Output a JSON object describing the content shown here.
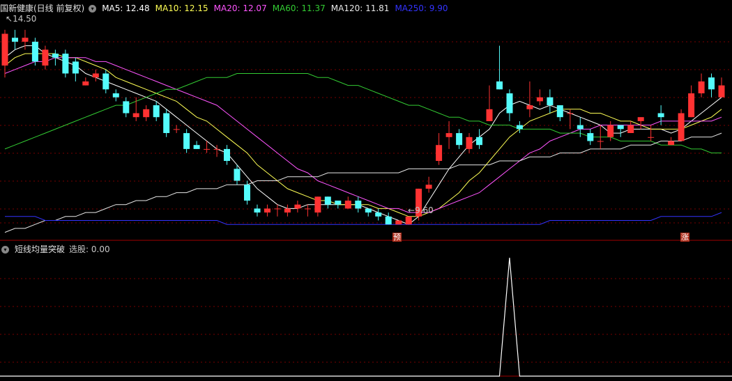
{
  "header": {
    "title": "国新健康(日线 前复权)",
    "ma": [
      {
        "label": "MA5: 12.48",
        "color": "#ffffff"
      },
      {
        "label": "MA10: 12.15",
        "color": "#ffff55"
      },
      {
        "label": "MA20: 12.07",
        "color": "#ff55ff"
      },
      {
        "label": "MA60: 11.37",
        "color": "#33cc33"
      },
      {
        "label": "MA120: 11.81",
        "color": "#e8e8e8"
      },
      {
        "label": "MA250: 9.90",
        "color": "#3333ff"
      }
    ]
  },
  "indicator": {
    "title": "短线均量突破",
    "value": "选股: 0.00"
  },
  "annotations": {
    "high": "14.50",
    "low": "9.60",
    "tag_pre": "预",
    "tag_rise": "涨"
  },
  "colors": {
    "up": "#ff3232",
    "down": "#54fcfc",
    "grid": "#7a0000",
    "border": "#a00000"
  },
  "chart_data": {
    "type": "candlestick",
    "ylim": [
      9.2,
      14.9
    ],
    "candles": [
      [
        13.6,
        14.4,
        14.5,
        13.3
      ],
      [
        14.3,
        14.2,
        14.5,
        14.0
      ],
      [
        14.2,
        14.3,
        14.5,
        14.0
      ],
      [
        14.2,
        13.7,
        14.3,
        13.6
      ],
      [
        13.6,
        14.0,
        14.1,
        13.5
      ],
      [
        13.9,
        13.8,
        14.0,
        13.6
      ],
      [
        13.9,
        13.4,
        14.0,
        13.3
      ],
      [
        13.7,
        13.4,
        13.8,
        13.2
      ],
      [
        13.1,
        13.2,
        13.3,
        13.1
      ],
      [
        13.3,
        13.4,
        13.5,
        13.2
      ],
      [
        13.4,
        13.0,
        13.5,
        12.9
      ],
      [
        12.9,
        12.8,
        13.0,
        12.7
      ],
      [
        12.7,
        12.4,
        12.8,
        12.3
      ],
      [
        12.3,
        12.4,
        12.8,
        12.2
      ],
      [
        12.3,
        12.5,
        12.6,
        12.2
      ],
      [
        12.6,
        12.3,
        12.7,
        12.2
      ],
      [
        12.4,
        11.9,
        12.5,
        11.8
      ],
      [
        12.0,
        12.0,
        12.1,
        11.9
      ],
      [
        11.9,
        11.5,
        12.0,
        11.4
      ],
      [
        11.6,
        11.5,
        11.7,
        11.5
      ],
      [
        11.5,
        11.5,
        11.7,
        11.4
      ],
      [
        11.5,
        11.5,
        11.6,
        11.3
      ],
      [
        11.5,
        11.2,
        11.6,
        11.1
      ],
      [
        11.0,
        10.7,
        11.1,
        10.6
      ],
      [
        10.6,
        10.2,
        10.7,
        10.1
      ],
      [
        10.0,
        9.9,
        10.1,
        9.8
      ],
      [
        9.9,
        10.0,
        10.1,
        9.8
      ],
      [
        10.0,
        10.0,
        10.1,
        9.8
      ],
      [
        9.9,
        10.0,
        10.1,
        9.8
      ],
      [
        10.0,
        10.1,
        10.2,
        9.9
      ],
      [
        10.0,
        10.0,
        10.1,
        9.8
      ],
      [
        9.9,
        10.3,
        10.3,
        9.8
      ],
      [
        10.3,
        10.1,
        10.3,
        10.0
      ],
      [
        10.2,
        10.1,
        10.2,
        10.0
      ],
      [
        10.0,
        10.2,
        10.3,
        10.0
      ],
      [
        10.2,
        10.0,
        10.3,
        9.9
      ],
      [
        10.0,
        9.9,
        10.0,
        9.8
      ],
      [
        9.9,
        9.8,
        10.0,
        9.7
      ],
      [
        9.8,
        9.6,
        9.9,
        9.6
      ],
      [
        9.6,
        9.7,
        9.7,
        9.6
      ],
      [
        9.6,
        9.8,
        9.8,
        9.6
      ],
      [
        9.8,
        10.5,
        10.5,
        9.7
      ],
      [
        10.5,
        10.6,
        10.8,
        10.4
      ],
      [
        11.2,
        11.6,
        11.9,
        11.1
      ],
      [
        11.8,
        11.9,
        12.2,
        11.5
      ],
      [
        11.9,
        11.6,
        12.0,
        11.5
      ],
      [
        11.5,
        11.8,
        11.9,
        11.4
      ],
      [
        11.8,
        11.6,
        12.0,
        11.5
      ],
      [
        12.2,
        12.5,
        13.1,
        12.2
      ],
      [
        13.2,
        13.0,
        14.1,
        13.0
      ],
      [
        12.9,
        12.4,
        13.0,
        12.2
      ],
      [
        12.1,
        12.0,
        12.2,
        11.9
      ],
      [
        12.5,
        12.6,
        13.2,
        12.3
      ],
      [
        12.7,
        12.8,
        13.0,
        12.6
      ],
      [
        12.8,
        12.6,
        13.0,
        12.4
      ],
      [
        12.6,
        12.3,
        12.6,
        12.2
      ],
      [
        12.4,
        12.4,
        12.5,
        12.0
      ],
      [
        12.1,
        12.0,
        12.3,
        11.8
      ],
      [
        11.9,
        11.7,
        12.0,
        11.6
      ],
      [
        11.7,
        11.7,
        12.1,
        11.5
      ],
      [
        11.8,
        12.1,
        12.2,
        11.7
      ],
      [
        12.1,
        12.0,
        12.1,
        11.8
      ],
      [
        11.9,
        12.1,
        12.2,
        11.9
      ],
      [
        12.2,
        12.3,
        12.3,
        12.0
      ],
      [
        11.8,
        11.8,
        12.1,
        11.7
      ],
      [
        12.4,
        12.3,
        12.6,
        12.1
      ],
      [
        11.6,
        11.7,
        11.8,
        11.6
      ],
      [
        11.7,
        12.4,
        12.5,
        11.7
      ],
      [
        12.3,
        12.9,
        13.1,
        12.3
      ],
      [
        12.9,
        13.2,
        13.4,
        12.8
      ],
      [
        13.3,
        13.0,
        13.4,
        12.8
      ],
      [
        12.8,
        13.1,
        13.3,
        12.8
      ]
    ],
    "ma": {
      "MA5": [
        13.8,
        14.0,
        14.1,
        14.1,
        13.9,
        13.8,
        13.7,
        13.6,
        13.4,
        13.3,
        13.2,
        13.1,
        13.0,
        12.9,
        12.8,
        12.7,
        12.5,
        12.3,
        12.1,
        11.9,
        11.7,
        11.5,
        11.4,
        11.1,
        10.8,
        10.5,
        10.3,
        10.1,
        10.0,
        10.0,
        10.1,
        10.1,
        10.1,
        10.1,
        10.1,
        10.1,
        10.0,
        9.9,
        9.8,
        9.7,
        9.6,
        9.8,
        10.2,
        10.6,
        11.0,
        11.3,
        11.6,
        11.8,
        12.0,
        12.4,
        12.6,
        12.7,
        12.6,
        12.5,
        12.6,
        12.5,
        12.4,
        12.3,
        12.2,
        12.1,
        11.9,
        11.9,
        12.0,
        12.0,
        12.0,
        12.0,
        11.9,
        12.0,
        12.2,
        12.4,
        12.6,
        12.8
      ],
      "MA10": [
        13.6,
        13.8,
        13.9,
        13.9,
        13.9,
        13.9,
        13.8,
        13.8,
        13.7,
        13.6,
        13.5,
        13.3,
        13.2,
        13.1,
        13.0,
        12.9,
        12.8,
        12.7,
        12.5,
        12.3,
        12.2,
        12.0,
        11.8,
        11.6,
        11.4,
        11.1,
        10.9,
        10.7,
        10.5,
        10.4,
        10.3,
        10.2,
        10.2,
        10.1,
        10.1,
        10.1,
        10.1,
        10.0,
        10.0,
        9.9,
        9.8,
        9.8,
        9.9,
        10.0,
        10.2,
        10.4,
        10.7,
        10.9,
        11.2,
        11.5,
        11.8,
        12.0,
        12.2,
        12.3,
        12.4,
        12.5,
        12.5,
        12.5,
        12.4,
        12.4,
        12.3,
        12.2,
        12.2,
        12.1,
        12.0,
        12.0,
        12.0,
        12.0,
        12.1,
        12.2,
        12.3,
        12.5
      ],
      "MA20": [
        13.4,
        13.5,
        13.6,
        13.7,
        13.7,
        13.8,
        13.8,
        13.8,
        13.8,
        13.7,
        13.7,
        13.6,
        13.5,
        13.4,
        13.3,
        13.2,
        13.1,
        13.0,
        12.9,
        12.8,
        12.7,
        12.6,
        12.4,
        12.2,
        12.0,
        11.8,
        11.6,
        11.4,
        11.2,
        11.0,
        10.9,
        10.7,
        10.6,
        10.5,
        10.4,
        10.3,
        10.2,
        10.1,
        10.0,
        10.0,
        9.9,
        9.9,
        9.9,
        10.0,
        10.1,
        10.2,
        10.3,
        10.4,
        10.6,
        10.8,
        11.0,
        11.2,
        11.4,
        11.5,
        11.7,
        11.8,
        11.9,
        12.0,
        12.0,
        12.1,
        12.1,
        12.1,
        12.1,
        12.1,
        12.1,
        12.2,
        12.2,
        12.2,
        12.2,
        12.2,
        12.2,
        12.3
      ],
      "MA60": [
        11.5,
        11.6,
        11.7,
        11.8,
        11.9,
        12.0,
        12.1,
        12.2,
        12.3,
        12.4,
        12.5,
        12.6,
        12.6,
        12.7,
        12.8,
        12.9,
        13.0,
        13.0,
        13.1,
        13.2,
        13.3,
        13.3,
        13.3,
        13.4,
        13.4,
        13.4,
        13.4,
        13.4,
        13.4,
        13.4,
        13.4,
        13.3,
        13.3,
        13.2,
        13.1,
        13.1,
        13.0,
        12.9,
        12.8,
        12.7,
        12.6,
        12.6,
        12.5,
        12.4,
        12.3,
        12.3,
        12.2,
        12.2,
        12.1,
        12.1,
        12.1,
        12.0,
        12.0,
        12.0,
        12.0,
        11.9,
        11.9,
        11.9,
        11.8,
        11.8,
        11.8,
        11.7,
        11.7,
        11.7,
        11.7,
        11.6,
        11.6,
        11.6,
        11.5,
        11.5,
        11.4,
        11.4
      ],
      "MA120": [
        9.4,
        9.5,
        9.5,
        9.6,
        9.7,
        9.7,
        9.8,
        9.8,
        9.9,
        9.9,
        10.0,
        10.1,
        10.1,
        10.2,
        10.2,
        10.3,
        10.3,
        10.4,
        10.4,
        10.5,
        10.5,
        10.5,
        10.6,
        10.6,
        10.6,
        10.7,
        10.7,
        10.7,
        10.8,
        10.8,
        10.8,
        10.8,
        10.9,
        10.9,
        10.9,
        10.9,
        10.9,
        10.9,
        10.9,
        10.9,
        11.0,
        11.0,
        11.0,
        11.0,
        11.0,
        11.1,
        11.1,
        11.1,
        11.1,
        11.2,
        11.2,
        11.2,
        11.3,
        11.3,
        11.3,
        11.4,
        11.4,
        11.4,
        11.5,
        11.5,
        11.5,
        11.5,
        11.6,
        11.6,
        11.6,
        11.7,
        11.7,
        11.7,
        11.8,
        11.8,
        11.8,
        11.9
      ],
      "MA250": [
        9.8,
        9.8,
        9.8,
        9.8,
        9.7,
        9.7,
        9.7,
        9.7,
        9.7,
        9.7,
        9.7,
        9.7,
        9.7,
        9.7,
        9.7,
        9.7,
        9.7,
        9.7,
        9.7,
        9.7,
        9.7,
        9.7,
        9.6,
        9.6,
        9.6,
        9.6,
        9.6,
        9.6,
        9.6,
        9.6,
        9.6,
        9.6,
        9.6,
        9.6,
        9.6,
        9.6,
        9.6,
        9.6,
        9.6,
        9.6,
        9.6,
        9.6,
        9.6,
        9.6,
        9.6,
        9.6,
        9.6,
        9.6,
        9.6,
        9.6,
        9.6,
        9.6,
        9.6,
        9.6,
        9.7,
        9.7,
        9.7,
        9.7,
        9.7,
        9.7,
        9.7,
        9.7,
        9.7,
        9.7,
        9.7,
        9.8,
        9.8,
        9.8,
        9.8,
        9.8,
        9.8,
        9.9
      ]
    },
    "signal": {
      "values_nonzero_index": 50,
      "values_peak": 1,
      "ylim": [
        0,
        1
      ]
    }
  }
}
